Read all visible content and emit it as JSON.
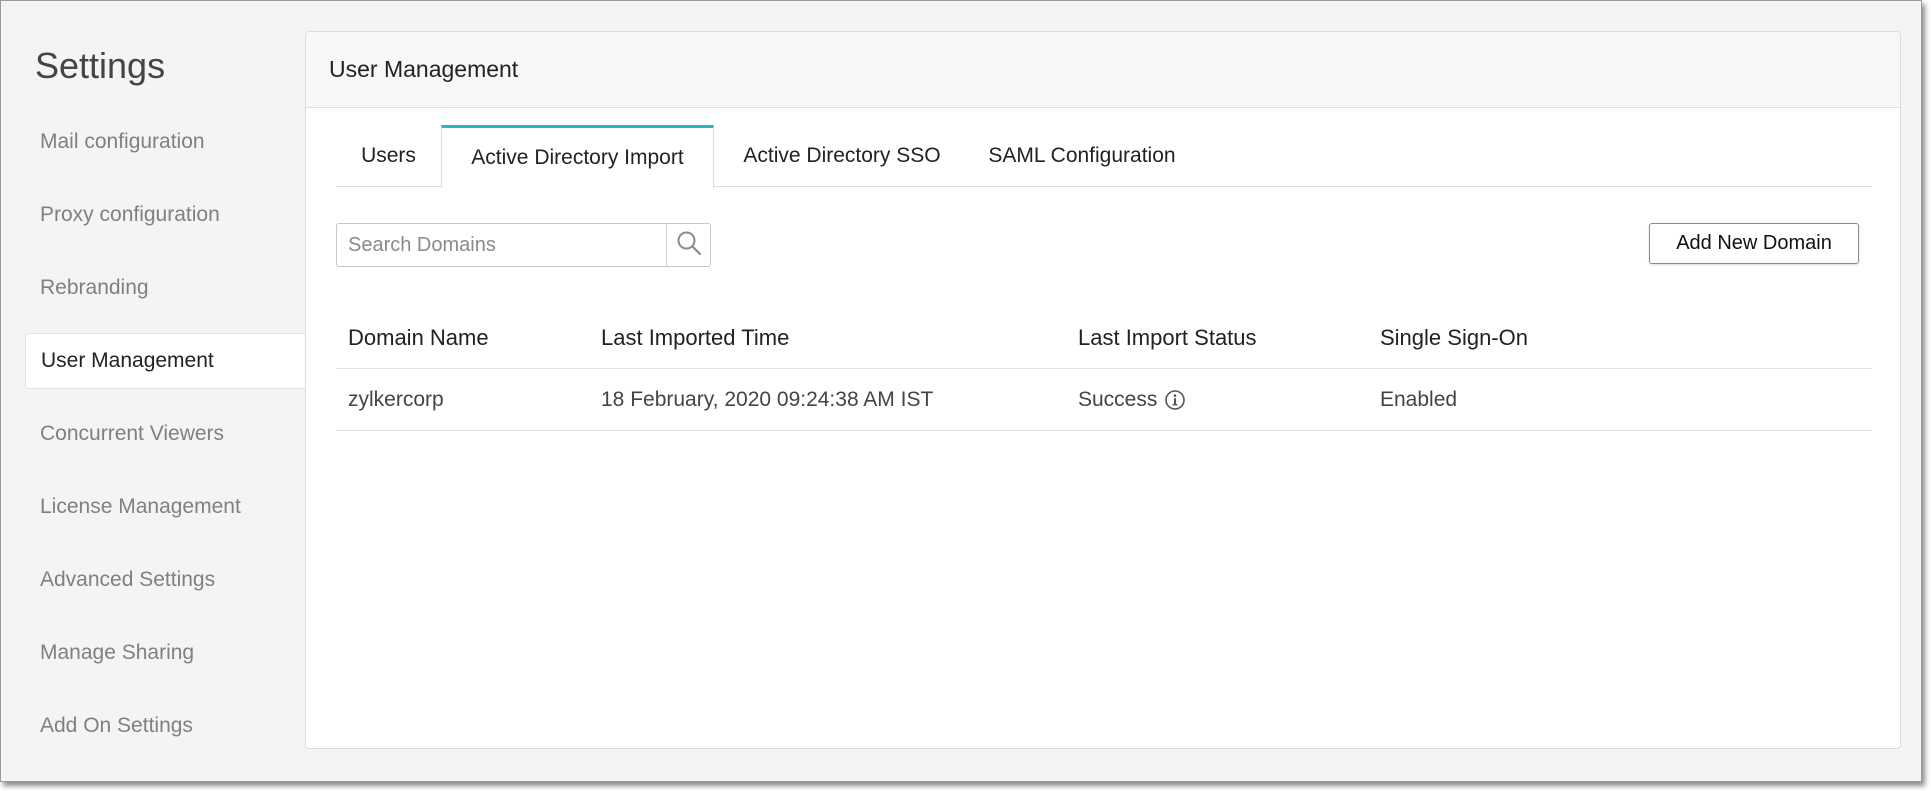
{
  "sidebar": {
    "title": "Settings",
    "items": [
      {
        "label": "Mail configuration",
        "active": false
      },
      {
        "label": "Proxy configuration",
        "active": false
      },
      {
        "label": "Rebranding",
        "active": false
      },
      {
        "label": "User Management",
        "active": true
      },
      {
        "label": "Concurrent Viewers",
        "active": false
      },
      {
        "label": "License Management",
        "active": false
      },
      {
        "label": "Advanced Settings",
        "active": false
      },
      {
        "label": "Manage Sharing",
        "active": false
      },
      {
        "label": "Add On Settings",
        "active": false
      }
    ]
  },
  "panel": {
    "title": "User Management",
    "tabs": [
      {
        "label": "Users",
        "active": false
      },
      {
        "label": "Active Directory Import",
        "active": true
      },
      {
        "label": "Active Directory SSO",
        "active": false
      },
      {
        "label": "SAML Configuration",
        "active": false
      }
    ],
    "search": {
      "placeholder": "Search Domains",
      "value": ""
    },
    "add_button_label": "Add New Domain",
    "table": {
      "columns": [
        "Domain Name",
        "Last Imported Time",
        "Last Import Status",
        "Single Sign-On"
      ],
      "rows": [
        [
          "zylkercorp",
          "18 February, 2020 09:24:38 AM IST",
          "Success",
          "Enabled"
        ]
      ]
    }
  },
  "colors": {
    "accent": "#2bb5ba",
    "background": "#f4f4f4",
    "panel": "#ffffff",
    "muted_text": "#808080"
  },
  "icons": {
    "search": "search-icon",
    "status_info": "info-icon"
  }
}
